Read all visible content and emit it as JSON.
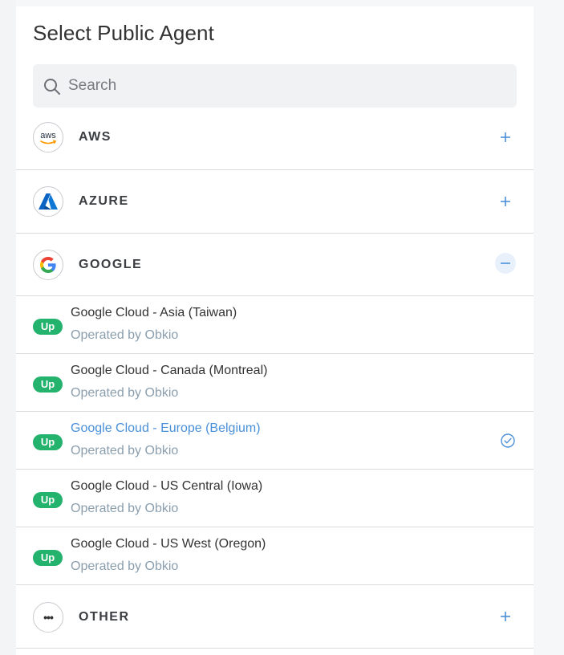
{
  "panel": {
    "title": "Select Public Agent"
  },
  "search": {
    "placeholder": "Search",
    "value": ""
  },
  "providers": [
    {
      "name": "AWS",
      "logo_text": "aws",
      "expanded": false,
      "toggle_icon": "plus-icon"
    },
    {
      "name": "AZURE",
      "logo_icon": "azure-logo-icon",
      "expanded": false,
      "toggle_icon": "plus-icon"
    },
    {
      "name": "GOOGLE",
      "logo_icon": "google-logo-icon",
      "expanded": true,
      "toggle_icon": "minus-icon"
    },
    {
      "name": "OTHER",
      "logo_text": "•••",
      "expanded": false,
      "toggle_icon": "plus-icon"
    }
  ],
  "google_agents": [
    {
      "name": "Google Cloud - Asia (Taiwan)",
      "operator": "Operated by Obkio",
      "status": "Up",
      "selected": false
    },
    {
      "name": "Google Cloud - Canada (Montreal)",
      "operator": "Operated by Obkio",
      "status": "Up",
      "selected": false
    },
    {
      "name": "Google Cloud - Europe (Belgium)",
      "operator": "Operated by Obkio",
      "status": "Up",
      "selected": true
    },
    {
      "name": "Google Cloud - US Central (Iowa)",
      "operator": "Operated by Obkio",
      "status": "Up",
      "selected": false
    },
    {
      "name": "Google Cloud - US West (Oregon)",
      "operator": "Operated by Obkio",
      "status": "Up",
      "selected": false
    }
  ],
  "colors": {
    "status_up": "#23b36d",
    "accent": "#4a90d9",
    "subtext": "#8a9eae"
  }
}
